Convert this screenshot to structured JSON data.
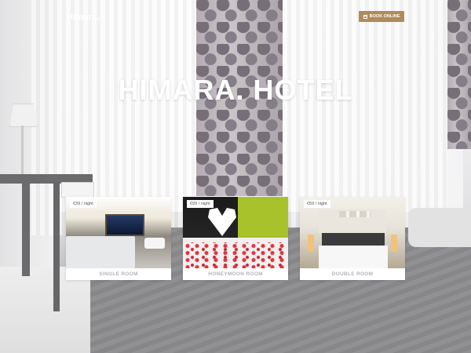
{
  "header": {
    "logo": "Himara.",
    "book_button_label": "BOOK ONLINE",
    "book_button_icon": "calendar-icon"
  },
  "hero": {
    "title": "HIMARA. HOTEL"
  },
  "rooms": [
    {
      "price": "€39 / night",
      "name": "SINGLE ROOM"
    },
    {
      "price": "€99 / night",
      "name": "HONEYMOON ROOM"
    },
    {
      "price": "€59 / night",
      "name": "DOUBLE ROOM"
    }
  ],
  "colors": {
    "accent": "#b08b5a",
    "title": "#ffffff",
    "card_label": "#b5b5b5"
  }
}
